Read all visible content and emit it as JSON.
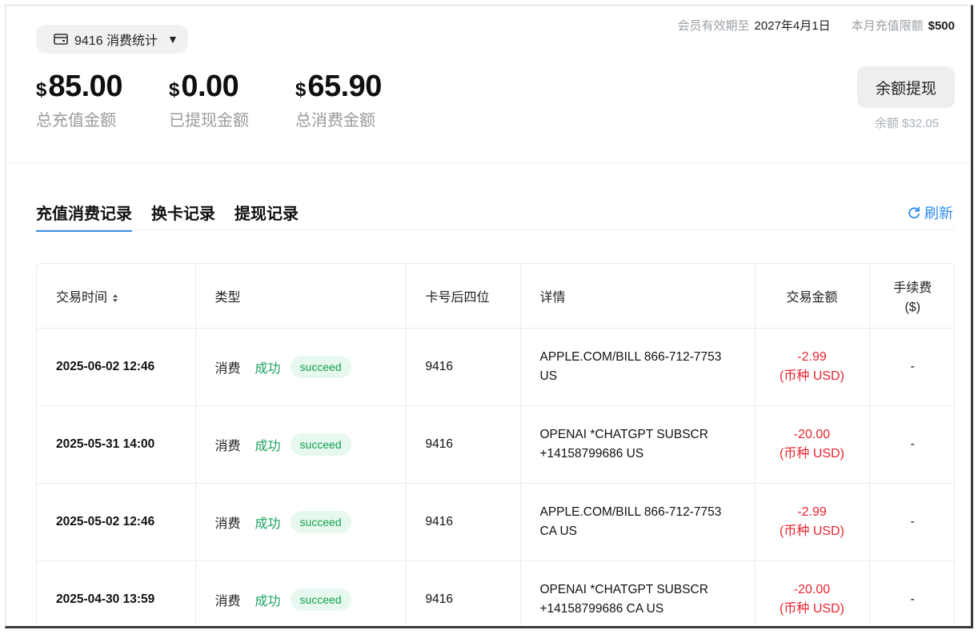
{
  "header": {
    "card_selector": {
      "label": "9416 消费统计",
      "icon": "wallet-icon"
    },
    "member_expiry_label": "会员有效期至",
    "member_expiry_value": "2027年4月1日",
    "monthly_limit_label": "本月充值限额",
    "monthly_limit_value": "$500"
  },
  "stats": [
    {
      "currency": "$",
      "value": "85.00",
      "label": "总充值金额"
    },
    {
      "currency": "$",
      "value": "0.00",
      "label": "已提现金额"
    },
    {
      "currency": "$",
      "value": "65.90",
      "label": "总消费金额"
    }
  ],
  "withdraw": {
    "button_label": "余额提现",
    "balance_text": "余额 $32.05"
  },
  "tabs": [
    {
      "label": "充值消费记录",
      "active": true
    },
    {
      "label": "换卡记录",
      "active": false
    },
    {
      "label": "提现记录",
      "active": false
    }
  ],
  "refresh": {
    "label": "刷新",
    "icon": "refresh-icon"
  },
  "table": {
    "columns": [
      "交易时间",
      "类型",
      "卡号后四位",
      "详情",
      "交易金额",
      "手续费",
      "($)"
    ],
    "rows": [
      {
        "time": "2025-06-02 12:46",
        "type": "消费",
        "status": "成功",
        "badge": "succeed",
        "card": "9416",
        "detail_1": "APPLE.COM/BILL 866-712-7753",
        "detail_2": "US",
        "amount": "-2.99",
        "currency": "(币种 USD)",
        "fee": "-"
      },
      {
        "time": "2025-05-31 14:00",
        "type": "消费",
        "status": "成功",
        "badge": "succeed",
        "card": "9416",
        "detail_1": "OPENAI *CHATGPT SUBSCR",
        "detail_2": "+14158799686 US",
        "amount": "-20.00",
        "currency": "(币种 USD)",
        "fee": "-"
      },
      {
        "time": "2025-05-02 12:46",
        "type": "消费",
        "status": "成功",
        "badge": "succeed",
        "card": "9416",
        "detail_1": "APPLE.COM/BILL 866-712-7753",
        "detail_2": "CA US",
        "amount": "-2.99",
        "currency": "(币种 USD)",
        "fee": "-"
      },
      {
        "time": "2025-04-30 13:59",
        "type": "消费",
        "status": "成功",
        "badge": "succeed",
        "card": "9416",
        "detail_1": "OPENAI *CHATGPT SUBSCR",
        "detail_2": "+14158799686 CA US",
        "amount": "-20.00",
        "currency": "(币种 USD)",
        "fee": "-"
      }
    ]
  },
  "colors": {
    "accent_blue": "#2d8cf0",
    "success_green": "#19a15f",
    "amount_red": "#e8242e",
    "muted_gray": "#9a9a9a"
  }
}
